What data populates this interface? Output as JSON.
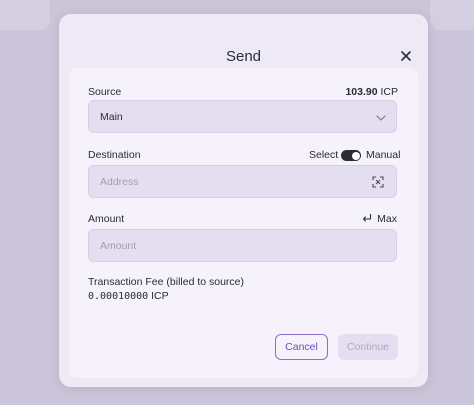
{
  "modal": {
    "title": "Send"
  },
  "source": {
    "label": "Source",
    "balance_value": "103.90",
    "balance_unit": "ICP",
    "selected": "Main"
  },
  "destination": {
    "label": "Destination",
    "toggle_left": "Select",
    "toggle_right": "Manual",
    "placeholder": "Address"
  },
  "amount": {
    "label": "Amount",
    "max_label": "Max",
    "placeholder": "Amount"
  },
  "fee": {
    "label": "Transaction Fee (billed to source)",
    "value": "0.00010000",
    "unit": "ICP"
  },
  "buttons": {
    "cancel": "Cancel",
    "continue": "Continue"
  },
  "icons": {
    "close": "close-icon",
    "chevron": "chevron-down-icon",
    "qr": "qr-scan-icon",
    "max_arrow": "return-arrow-icon"
  }
}
